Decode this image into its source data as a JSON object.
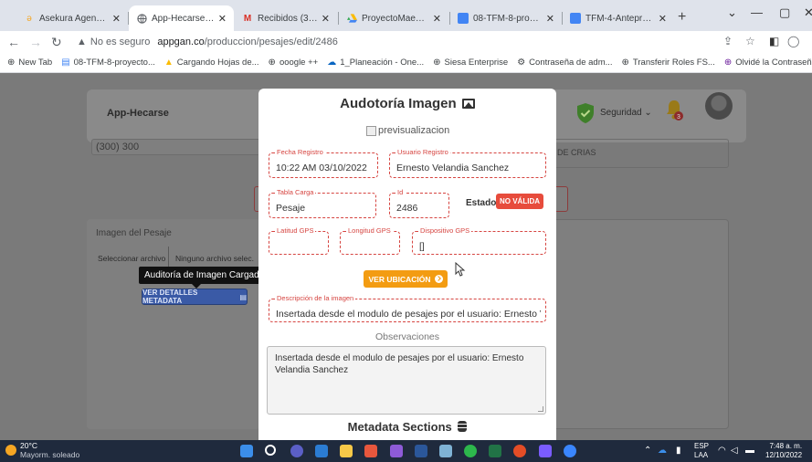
{
  "browser": {
    "tabs": [
      {
        "label": "Asekura Agencia de Se",
        "icon": "asekura-icon",
        "color": "#f5a623"
      },
      {
        "label": "App-Hecarse | Editar P",
        "icon": "globe-icon",
        "color": "#5f6368",
        "active": true
      },
      {
        "label": "Recibidos (312) - vela",
        "icon": "gmail-icon",
        "color": "#d93025"
      },
      {
        "label": "ProyectoMaestria - Go",
        "icon": "drive-icon",
        "color": "#fbbc04"
      },
      {
        "label": "08-TFM-8-proyecto.do",
        "icon": "docs-icon",
        "color": "#4285f4"
      },
      {
        "label": "TFM-4-Anteproyecto.",
        "icon": "docs-icon",
        "color": "#4285f4"
      }
    ],
    "new_tab": "+",
    "window": {
      "dropdown": "⌄",
      "minimize": "—",
      "maximize": "▢",
      "close": "✕"
    },
    "address": {
      "security": "No es seguro",
      "host": "appgan.co",
      "path": "/produccion/pesajes/edit/2486"
    },
    "bookmarks": [
      {
        "label": "New Tab",
        "icon": "globe-icon"
      },
      {
        "label": "08-TFM-8-proyecto...",
        "icon": "docs-icon"
      },
      {
        "label": "Cargando Hojas de...",
        "icon": "drive-icon"
      },
      {
        "label": "ooogle ++",
        "icon": "globe-icon"
      },
      {
        "label": "1_Planeación - One...",
        "icon": "onedrive-icon"
      },
      {
        "label": "Siesa Enterprise",
        "icon": "globe-icon"
      },
      {
        "label": "Contraseña de adm...",
        "icon": "gear-icon"
      },
      {
        "label": "Transferir Roles FS...",
        "icon": "globe-icon"
      },
      {
        "label": "Olvidé la Contraseñ...",
        "icon": "globe-icon"
      }
    ]
  },
  "app": {
    "title": "App-Hecarse",
    "security_menu": "Seguridad",
    "notifications": "3",
    "phone_value": "(300) 300",
    "crias_label": "DE CRIAS",
    "imagen_label": "Imagen del Pesaje",
    "file_button": "Seleccionar archivo",
    "file_none": "Ninguno archivo selec.",
    "tooltip": "Auditoría de Imagen Cargada",
    "metadata_button": "VER DETALLES METADATA"
  },
  "modal": {
    "title": "Audotoría Imagen",
    "preview_alt": "previsualizacion",
    "fields": {
      "fecha_label": "Fecha Registro",
      "fecha_value": "10:22 AM 03/10/2022",
      "usuario_label": "Usuario Registro",
      "usuario_value": "Ernesto Velandia Sanchez",
      "tabla_label": "Tabla Carga",
      "tabla_value": "Pesaje",
      "id_label": "Id",
      "id_value": "2486",
      "latitud_label": "Latitud GPS",
      "latitud_value": "",
      "longitud_label": "Longitud GPS",
      "longitud_value": "",
      "dispositivo_label": "Dispositivo GPS",
      "dispositivo_value": "[]",
      "descripcion_label": "Descripción de la imagen",
      "descripcion_value": "Insertada desde el modulo de pesajes por el usuario: Ernesto Velandia Sanchez"
    },
    "estado_label": "Estado",
    "estado_badge": "NO VÁLIDA",
    "ubicacion_button": "VER UBICACIÓN",
    "observaciones_label": "Observaciones",
    "observaciones_value": "Insertada desde el modulo de pesajes por el usuario: Ernesto Velandia Sanchez",
    "metadata_heading": "Metadata Sections"
  },
  "taskbar": {
    "temperature": "20°C",
    "weather": "Mayorm. soleado",
    "language": "ESP",
    "language_sub": "LAA",
    "time": "7:48 a. m.",
    "date": "12/10/2022"
  },
  "colors": {
    "accent_orange": "#f39c12",
    "error_red": "#e74c3c",
    "field_border": "#d64541"
  }
}
